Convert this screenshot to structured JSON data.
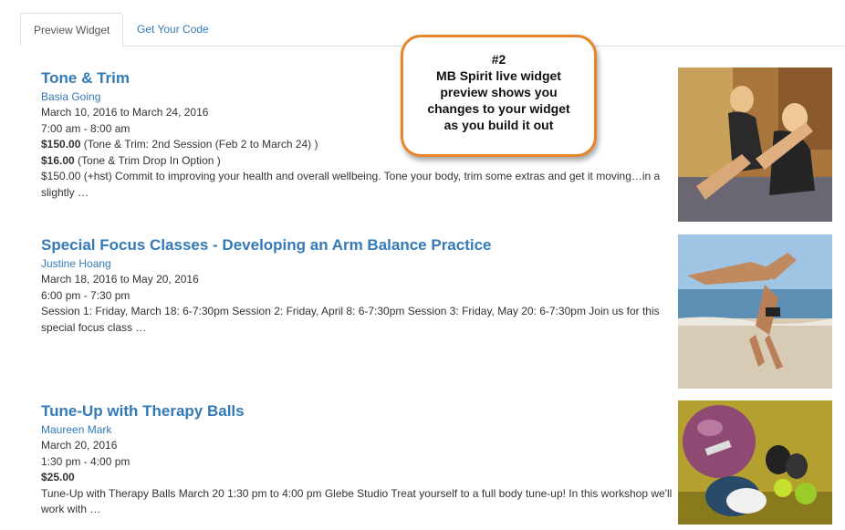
{
  "tabs": [
    {
      "label": "Preview Widget",
      "active": true
    },
    {
      "label": "Get Your Code",
      "active": false
    }
  ],
  "callout": {
    "number": "#2",
    "lines": [
      "MB Spirit live widget",
      "preview shows you",
      "changes to your widget",
      "as you build it out"
    ],
    "border_color": "#e8842a"
  },
  "events": [
    {
      "title": "Tone & Trim",
      "host": "Basia Going",
      "dates": "March 10, 2016 to March 24, 2016",
      "time": "7:00 am - 8:00 am",
      "prices": [
        {
          "amount": "$150.00",
          "note": " (Tone & Trim: 2nd Session (Feb 2 to March 24) )"
        },
        {
          "amount": "$16.00",
          "note": " (Tone & Trim Drop In Option )"
        }
      ],
      "description": "$150.00 (+hst) Commit to improving your health and overall wellbeing. Tone your body, trim some extras and get it moving…in a slightly  …",
      "image": "pilates-partner-photo"
    },
    {
      "title": "Special Focus Classes - Developing an Arm Balance Practice",
      "host": "Justine Hoang",
      "dates": "March 18, 2016 to May 20, 2016",
      "time": "6:00 pm - 7:30 pm",
      "prices": [],
      "description": "Session 1: Friday, March 18: 6-7:30pm Session 2: Friday, April 8: 6-7:30pm Session 3: Friday, May 20: 6-7:30pm Join us for this special focus class  …",
      "image": "beach-handstand-photo"
    },
    {
      "title": "Tune-Up with Therapy Balls",
      "host": "Maureen Mark",
      "dates": "March 20, 2016",
      "time": "1:30 pm - 4:00 pm",
      "prices": [
        {
          "amount": "$25.00",
          "note": ""
        }
      ],
      "description": "Tune-Up with Therapy Balls March 20 1:30 pm to 4:00 pm Glebe Studio Treat yourself to a full body tune-up! In this workshop we'll work with  …",
      "image": "therapy-balls-photo"
    }
  ],
  "colors": {
    "link": "#337ab7",
    "text": "#333333",
    "accent": "#e8842a"
  }
}
